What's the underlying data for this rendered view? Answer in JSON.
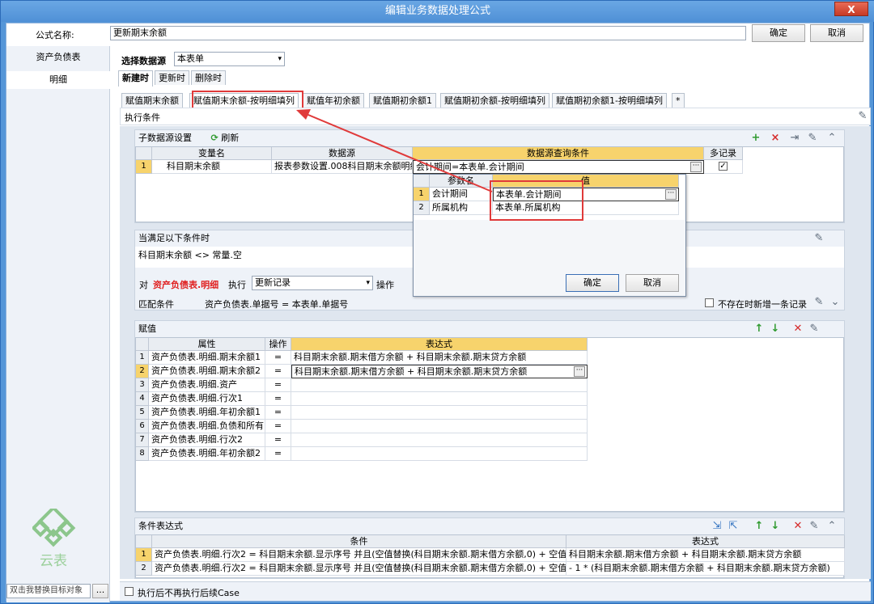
{
  "window": {
    "title": "编辑业务数据处理公式",
    "close": "X"
  },
  "top": {
    "formula_name_label": "公式名称:",
    "formula_name_value": "更新期末余额",
    "ok": "确定",
    "cancel": "取消"
  },
  "sidebar": {
    "items": [
      {
        "label": "资产负债表"
      },
      {
        "label": "明细"
      }
    ],
    "bottom_input": "双击我替换目标对象",
    "bottom_btn": "..."
  },
  "datasource": {
    "label": "选择数据源",
    "value": "本表单"
  },
  "mode_tabs": [
    {
      "label": "新建时"
    },
    {
      "label": "更新时"
    },
    {
      "label": "删除时"
    }
  ],
  "sub_tabs": [
    {
      "label": "赋值期末余额"
    },
    {
      "label": "赋值期末余额-按明细填列"
    },
    {
      "label": "赋值年初余额"
    },
    {
      "label": "赋值期初余额1"
    },
    {
      "label": "赋值期初余额-按明细填列"
    },
    {
      "label": "赋值期初余额1-按明细填列"
    },
    {
      "label": "*"
    }
  ],
  "exec_cond": {
    "label": "执行条件"
  },
  "subsource": {
    "title": "子数据源设置",
    "refresh": "刷新",
    "headers": [
      "变量名",
      "数据源",
      "数据源查询条件",
      "多记录"
    ],
    "rows": [
      {
        "n": "1",
        "var": "科目期末余额",
        "src": "报表参数设置.008科目期末余额明细",
        "cond": "会计期间=本表单.会计期间",
        "multi": true
      }
    ]
  },
  "popup": {
    "headers": [
      "参数名",
      "值"
    ],
    "rows": [
      {
        "n": "1",
        "name": "会计期间",
        "value": "本表单.会计期间"
      },
      {
        "n": "2",
        "name": "所属机构",
        "value": "本表单.所属机构"
      }
    ],
    "ok": "确定",
    "cancel": "取消"
  },
  "when": {
    "title": "当满足以下条件时",
    "expr": "科目期末余额 <> 常量.空",
    "target_pre": "对",
    "target": "资产负债表.明细",
    "exec": "执行",
    "action": "更新记录",
    "op": "操作",
    "match_label": "匹配条件",
    "match_expr": "资产负债表.单据号 = 本表单.单据号",
    "notexist": "不存在时新增一条记录"
  },
  "assign": {
    "title": "赋值",
    "headers": [
      "属性",
      "操作",
      "表达式"
    ],
    "rows": [
      {
        "n": "1",
        "prop": "资产负债表.明细.期末余额1",
        "op": "=",
        "expr": "科目期末余额.期末借方余额 + 科目期末余额.期末贷方余额"
      },
      {
        "n": "2",
        "prop": "资产负债表.明细.期末余额2",
        "op": "=",
        "expr": "科目期末余额.期末借方余额 + 科目期末余额.期末贷方余额"
      },
      {
        "n": "3",
        "prop": "资产负债表.明细.资产",
        "op": "=",
        "expr": ""
      },
      {
        "n": "4",
        "prop": "资产负债表.明细.行次1",
        "op": "=",
        "expr": ""
      },
      {
        "n": "5",
        "prop": "资产负债表.明细.年初余额1",
        "op": "=",
        "expr": ""
      },
      {
        "n": "6",
        "prop": "资产负债表.明细.负债和所有",
        "op": "=",
        "expr": ""
      },
      {
        "n": "7",
        "prop": "资产负债表.明细.行次2",
        "op": "=",
        "expr": ""
      },
      {
        "n": "8",
        "prop": "资产负债表.明细.年初余额2",
        "op": "=",
        "expr": ""
      }
    ]
  },
  "condexpr": {
    "title": "条件表达式",
    "headers": [
      "条件",
      "表达式"
    ],
    "rows": [
      {
        "n": "1",
        "cond": "资产负债表.明细.行次2 = 科目期末余额.显示序号 并且(空值替换(科目期末余额.期末借方余额,0) + 空值",
        "expr": "科目期末余额.期末借方余额 + 科目期末余额.期末贷方余额"
      },
      {
        "n": "2",
        "cond": "资产负债表.明细.行次2 = 科目期末余额.显示序号 并且(空值替换(科目期末余额.期末借方余额,0) + 空值",
        "expr": "- 1 * (科目期末余额.期末借方余额 + 科目期末余额.期末贷方余额)"
      }
    ]
  },
  "footer": {
    "checkbox_label": "执行后不再执行后续Case"
  },
  "logo": {
    "text": "云表"
  }
}
